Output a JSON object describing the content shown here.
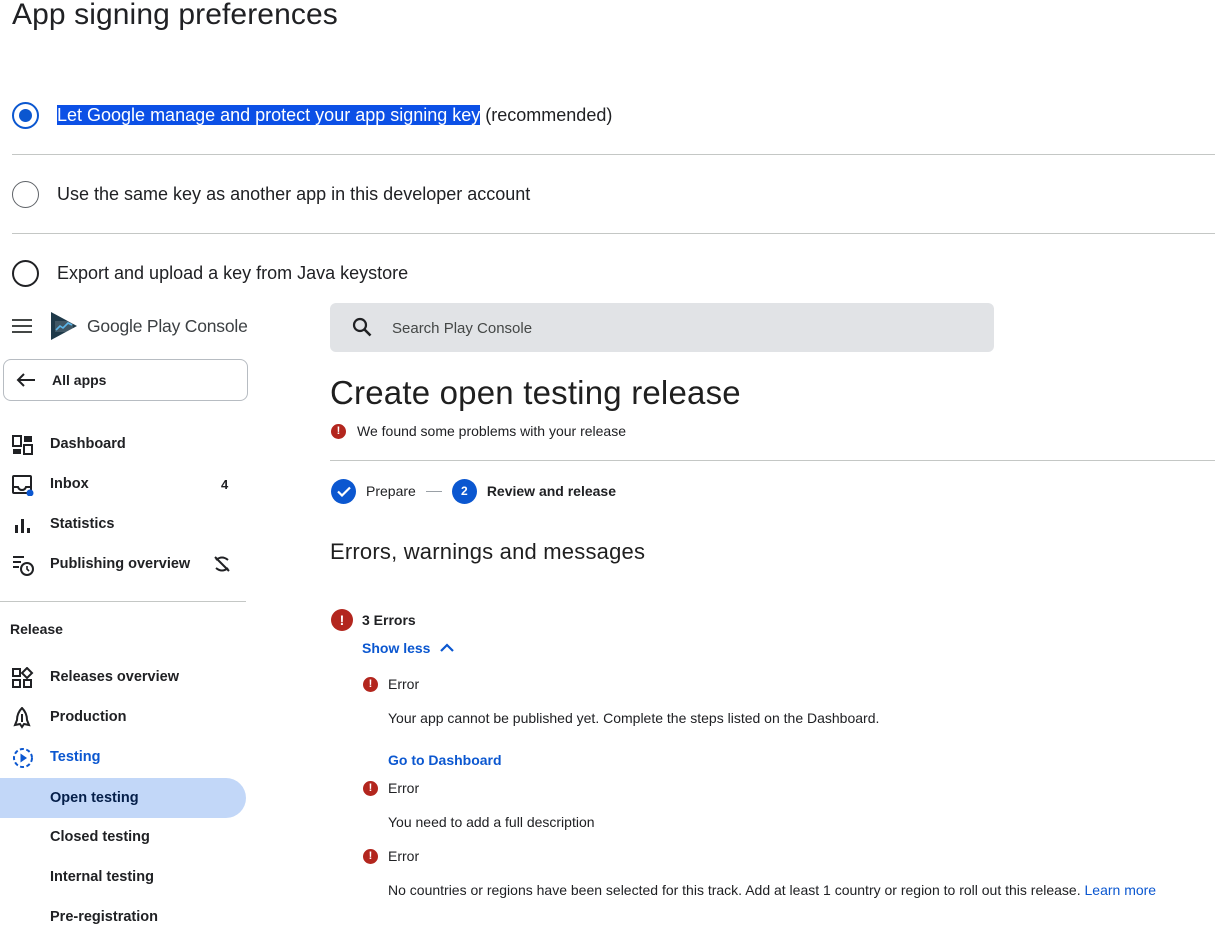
{
  "signing": {
    "title": "App signing preferences",
    "options": [
      {
        "label_highlighted": "Let Google manage and protect your app signing key",
        "label_suffix": " (recommended)",
        "selected": true
      },
      {
        "label": "Use the same key as another app in this developer account",
        "selected": false
      },
      {
        "label": "Export and upload a key from Java keystore",
        "selected": false
      }
    ]
  },
  "brand": {
    "logo_text": "Google Play Console"
  },
  "sidebar": {
    "all_apps": "All apps",
    "items": [
      {
        "label": "Dashboard",
        "icon": "dashboard-icon"
      },
      {
        "label": "Inbox",
        "icon": "inbox-icon",
        "badge": "4"
      },
      {
        "label": "Statistics",
        "icon": "bar-chart-icon"
      },
      {
        "label": "Publishing overview",
        "icon": "publishing-overview-icon",
        "extra_icon": "sync-off-icon"
      }
    ],
    "section_label": "Release",
    "release_items": [
      {
        "label": "Releases overview",
        "icon": "releases-overview-icon"
      },
      {
        "label": "Production",
        "icon": "production-icon"
      },
      {
        "label": "Testing",
        "icon": "testing-icon"
      },
      {
        "label": "Open testing"
      },
      {
        "label": "Closed testing"
      },
      {
        "label": "Internal testing"
      },
      {
        "label": "Pre-registration"
      }
    ]
  },
  "search": {
    "placeholder": "Search Play Console"
  },
  "main": {
    "title": "Create open testing release",
    "problem_text": "We found some problems with your release",
    "steps": [
      {
        "label": "Prepare",
        "state": "done"
      },
      {
        "label": "Review and release",
        "number": "2",
        "state": "current"
      }
    ],
    "section_heading": "Errors, warnings and messages",
    "error_icon_glyph": "!",
    "errors_count": "3 Errors",
    "show_less": "Show less",
    "errors": [
      {
        "title": "Error",
        "text": "Your app cannot be published yet. Complete the steps listed on the Dashboard.",
        "link": "Go to Dashboard"
      },
      {
        "title": "Error",
        "text": "You need to add a full description"
      },
      {
        "title": "Error",
        "text": "No countries or regions have been selected for this track. Add at least 1 country or region to roll out this release.",
        "link": "Learn more"
      }
    ]
  },
  "colors": {
    "accent": "#0b57d0",
    "error": "#b3261e",
    "selected_nav": "#c2d7f8",
    "search_bg": "#e1e3e6",
    "text_highlight": "#0c50e6"
  }
}
